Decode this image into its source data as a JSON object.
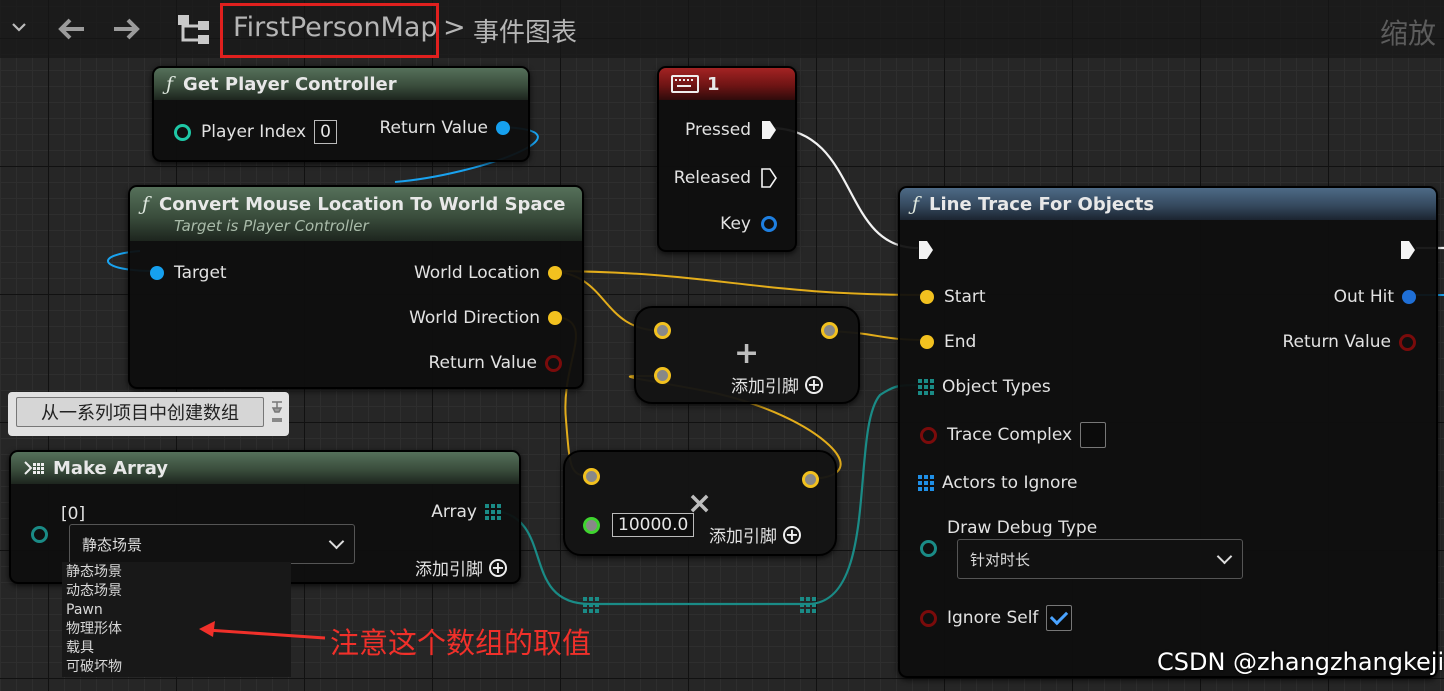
{
  "toolbar": {
    "breadcrumb_map": "FirstPersonMap",
    "breadcrumb_separator": ">",
    "breadcrumb_graph": "事件图表",
    "zoom_label": "缩放"
  },
  "nodes": {
    "get_player_controller": {
      "title": "Get Player Controller",
      "player_index_label": "Player Index",
      "player_index_value": "0",
      "return_value_label": "Return Value"
    },
    "convert_mouse": {
      "title": "Convert Mouse Location To World Space",
      "subtitle": "Target is Player Controller",
      "target_label": "Target",
      "world_location_label": "World Location",
      "world_direction_label": "World Direction",
      "return_value_label": "Return Value"
    },
    "key_event": {
      "title": "1",
      "pressed_label": "Pressed",
      "released_label": "Released",
      "key_label": "Key"
    },
    "line_trace": {
      "title": "Line Trace For Objects",
      "start_label": "Start",
      "end_label": "End",
      "out_hit_label": "Out Hit",
      "return_value_label": "Return Value",
      "object_types_label": "Object Types",
      "trace_complex_label": "Trace Complex",
      "trace_complex_checked": false,
      "actors_to_ignore_label": "Actors to Ignore",
      "draw_debug_type_label": "Draw Debug Type",
      "draw_debug_type_value": "针对时长",
      "ignore_self_label": "Ignore Self",
      "ignore_self_checked": true
    },
    "add_node": {
      "operator": "+",
      "add_pin_label": "添加引脚"
    },
    "multiply_node": {
      "operator": "×",
      "value": "10000.0",
      "add_pin_label": "添加引脚"
    },
    "make_array": {
      "title": "Make Array",
      "index_label": "[0]",
      "dropdown_value": "静态场景",
      "array_label": "Array",
      "add_pin_label": "添加引脚"
    }
  },
  "tooltip": {
    "text": "从一系列项目中创建数组"
  },
  "dropdown_options": [
    "静态场景",
    "动态场景",
    "Pawn",
    "物理形体",
    "载具",
    "可破坏物"
  ],
  "annotation": {
    "text": "注意这个数组的取值",
    "color": "#f0302a"
  },
  "watermark": "CSDN @zhangzhangkeji",
  "colors": {
    "vector_pin": "#f2c11f",
    "object_pin": "#16a0ee",
    "bool_pin": "#7a0b0b",
    "object_type_pin": "#1a8b86",
    "float_pin": "#3fd42f",
    "highlight_box": "#e0201e"
  }
}
